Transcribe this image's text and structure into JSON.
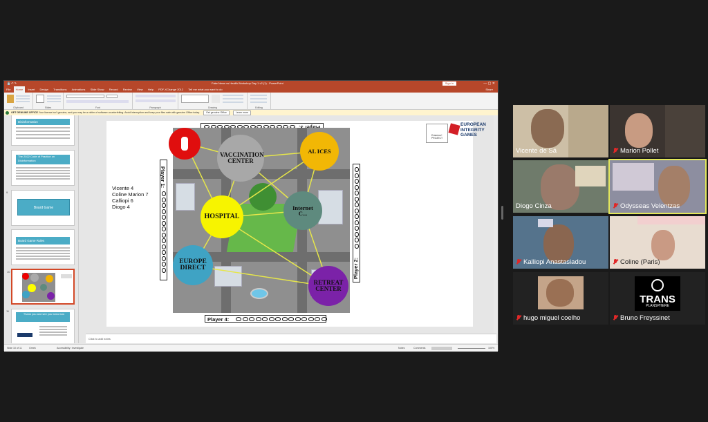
{
  "ppt": {
    "window_title": "Fake News vs Health Workshop Day 1 v2 (1) - PowerPoint",
    "sign_in": "Sign in",
    "tabs": [
      "File",
      "Home",
      "Insert",
      "Design",
      "Transitions",
      "Animations",
      "Slide Show",
      "Record",
      "Review",
      "View",
      "Help",
      "PDF-XChange 2012",
      "Tell me what you want to do"
    ],
    "share": "Share",
    "ribbon_groups": [
      "Clipboard",
      "Slides",
      "Font",
      "Paragraph",
      "Drawing",
      "Editing"
    ],
    "notice": {
      "label": "GET GENUINE OFFICE",
      "text": "Your license isn't genuine, and you may be a victim of software counterfeiting. Avoid interruption and keep your files safe with genuine Office today.",
      "btn1": "Get genuine Office",
      "btn2": "Learn more"
    },
    "thumbnails": [
      {
        "num": "",
        "title": "Disinformation"
      },
      {
        "num": "",
        "title": "The 2022 Code of Practice on Disinformation"
      },
      {
        "num": "9",
        "title": "Board Game"
      },
      {
        "num": "",
        "title": "Board Game Rules"
      },
      {
        "num": "10",
        "title": ""
      },
      {
        "num": "11",
        "title": "Thank you and see you tomorrow"
      }
    ],
    "notes_placeholder": "Click to add notes",
    "status": {
      "slide": "Slide 10 of 11",
      "lang": "Greek",
      "accessibility": "Accessibility: Investigate",
      "notes": "Notes",
      "comments": "Comments",
      "zoom": "100%"
    }
  },
  "slide": {
    "scores": [
      "Vicente 4",
      "Coline Marion 7",
      "Calliopi 6",
      "Diogo 4"
    ],
    "players": {
      "p1": "Player 1:",
      "p2": "Player 2:",
      "p3": "Player 3:",
      "p4": "Player 4:"
    },
    "nodes": {
      "red": "",
      "vaccination": "VACCINATION CENTER",
      "yellow_right": "AL ICES",
      "hospital": "HOSPITAL",
      "internet": "Internet C...",
      "europe": "EUROPE DIRECT",
      "retreat": "RETREAT CENTER"
    },
    "logo": {
      "small": "Erasmus+ PROJECT",
      "line1": "EUROPEAN",
      "line2": "INTEGRITY",
      "line3": "GAMES"
    }
  },
  "participants": [
    {
      "name": "Vicente de Sá",
      "muted": false,
      "active": false
    },
    {
      "name": "Marion Pollet",
      "muted": true,
      "active": false
    },
    {
      "name": "Diogo Cinza",
      "muted": false,
      "active": false
    },
    {
      "name": "Odysseas Velentzas",
      "muted": true,
      "active": true
    },
    {
      "name": "Kalliopi Anastasiadou",
      "muted": true,
      "active": false
    },
    {
      "name": "Coline (Paris)",
      "muted": true,
      "active": false
    },
    {
      "name": "hugo miguel coelho",
      "muted": true,
      "active": false
    },
    {
      "name": "Bruno Freyssinet",
      "muted": true,
      "active": false
    }
  ],
  "trans_logo": {
    "big": "TRANS",
    "small": "PLANSPHERE"
  },
  "colors": {
    "ppt_accent": "#b7472a",
    "active_speaker": "#e4e85b",
    "muted_icon": "#e02828"
  }
}
